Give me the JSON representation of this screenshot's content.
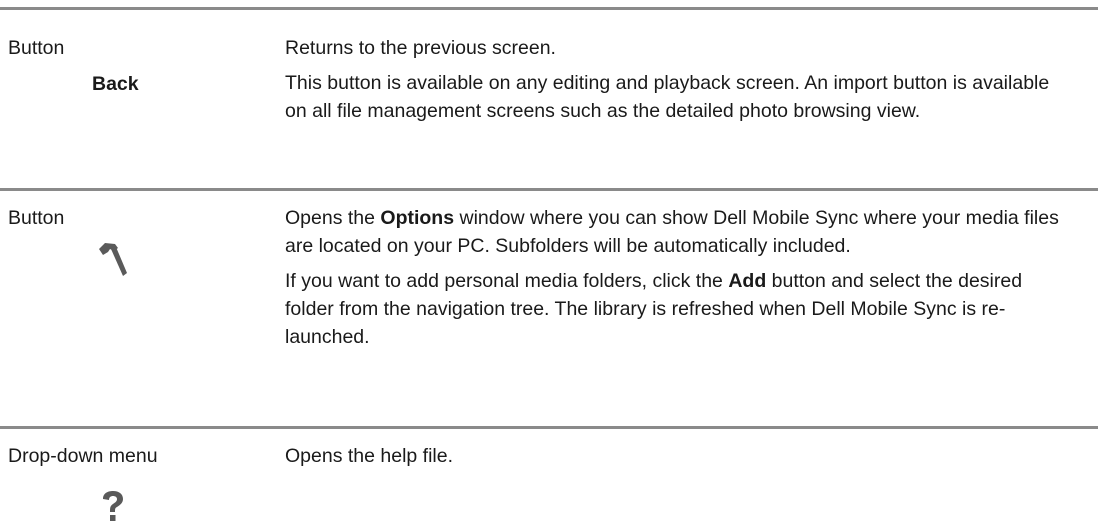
{
  "rows": [
    {
      "type": "Button",
      "control_label": "Back",
      "descriptions": [
        "Returns to the previous screen.",
        "This button is available on any editing and playback screen. An import button is available on all file management screens such as the detailed photo browsing view."
      ]
    },
    {
      "type": "Button",
      "icon": "hammer-icon",
      "descriptions": [
        {
          "pre": "Opens the ",
          "bold": "Options",
          "post": " window where you can show Dell Mobile Sync where your media files are located on your PC. Subfolders will be automatically included."
        },
        {
          "pre": "If you want to add personal media folders, click the ",
          "bold": "Add",
          "post": " button and select the desired folder from the navigation tree. The library is refreshed when Dell Mobile Sync is re-launched."
        }
      ]
    },
    {
      "type": "Drop-down menu",
      "icon": "question-mark-icon",
      "descriptions": [
        "Opens the help file."
      ]
    }
  ],
  "colors": {
    "rule": "#8a8a8a",
    "text": "#1a1a1a",
    "icon": "#5a5a5a"
  }
}
